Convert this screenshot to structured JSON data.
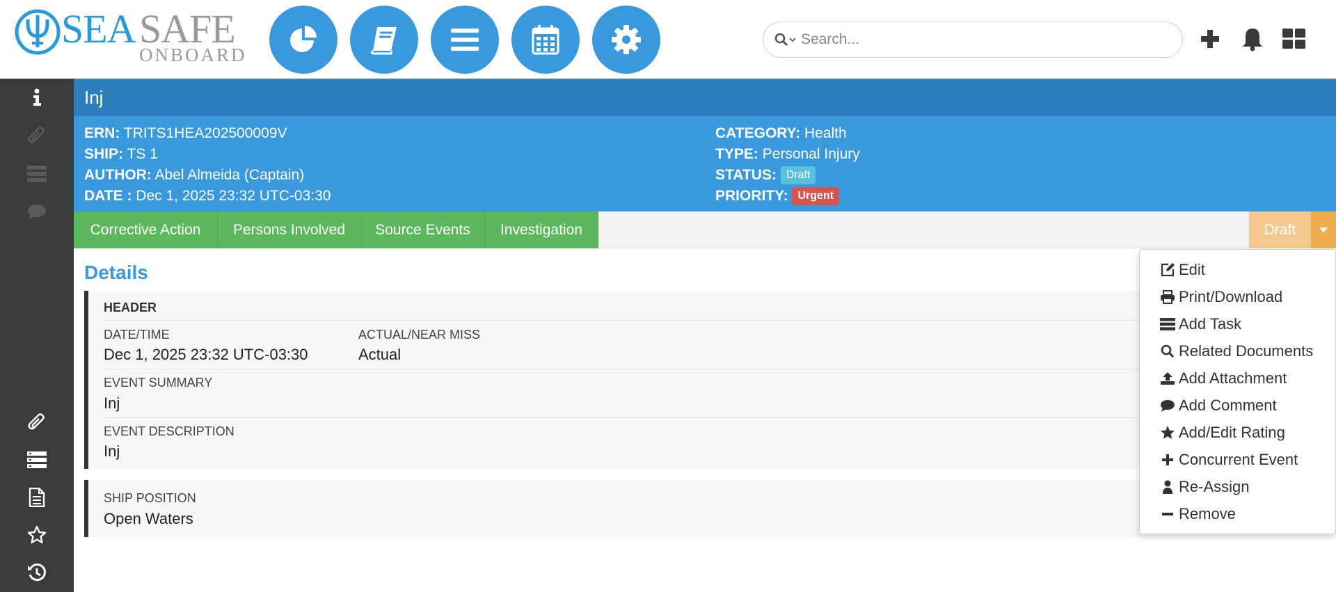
{
  "logo": {
    "sea": "SEA",
    "safe": "SAFE",
    "onboard": "ONBOARD"
  },
  "nav": [
    {
      "name": "dashboard",
      "icon": "pie-chart-icon"
    },
    {
      "name": "library",
      "icon": "book-icon"
    },
    {
      "name": "list",
      "icon": "menu-lines-icon"
    },
    {
      "name": "calendar",
      "icon": "calendar-icon"
    },
    {
      "name": "settings",
      "icon": "gear-icon"
    }
  ],
  "search": {
    "placeholder": "Search..."
  },
  "title": "Inj",
  "info": {
    "ern_label": "ERN:",
    "ern": "TRITS1HEA202500009V",
    "ship_label": "SHIP:",
    "ship": "TS 1",
    "author_label": "AUTHOR:",
    "author": "Abel Almeida (Captain)",
    "date_label": "DATE :",
    "date": "Dec 1, 2025 23:32 UTC-03:30",
    "category_label": "CATEGORY:",
    "category": "Health",
    "type_label": "TYPE:",
    "type": "Personal Injury",
    "status_label": "STATUS:",
    "status": "Draft",
    "priority_label": "PRIORITY:",
    "priority": "Urgent"
  },
  "tabs": [
    "Corrective Action",
    "Persons Involved",
    "Source Events",
    "Investigation"
  ],
  "status_button": "Draft",
  "details": {
    "title": "Details",
    "header": "HEADER",
    "datetime_label": "DATE/TIME",
    "datetime": "Dec 1, 2025 23:32 UTC-03:30",
    "actual_label": "ACTUAL/NEAR MISS",
    "actual": "Actual",
    "summary_label": "EVENT SUMMARY",
    "summary": "Inj",
    "description_label": "EVENT DESCRIPTION",
    "description": "Inj",
    "position_label": "SHIP POSITION",
    "position": "Open Waters"
  },
  "menu": [
    {
      "label": "Edit",
      "icon": "edit-icon"
    },
    {
      "label": "Print/Download",
      "icon": "print-icon"
    },
    {
      "label": "Add Task",
      "icon": "tasks-icon"
    },
    {
      "label": "Related Documents",
      "icon": "search-icon"
    },
    {
      "label": "Add Attachment",
      "icon": "upload-icon"
    },
    {
      "label": "Add Comment",
      "icon": "comment-icon"
    },
    {
      "label": "Add/Edit Rating",
      "icon": "star-icon"
    },
    {
      "label": "Concurrent Event",
      "icon": "plus-icon"
    },
    {
      "label": "Re-Assign",
      "icon": "user-icon"
    },
    {
      "label": "Remove",
      "icon": "minus-icon"
    }
  ],
  "colors": {
    "brand": "#3a98dc",
    "title_bar": "#2b80bb",
    "tab_green": "#5cb85c",
    "warning": "#f0ad4e",
    "danger": "#d9534f",
    "sidebar": "#3b3b3b"
  }
}
